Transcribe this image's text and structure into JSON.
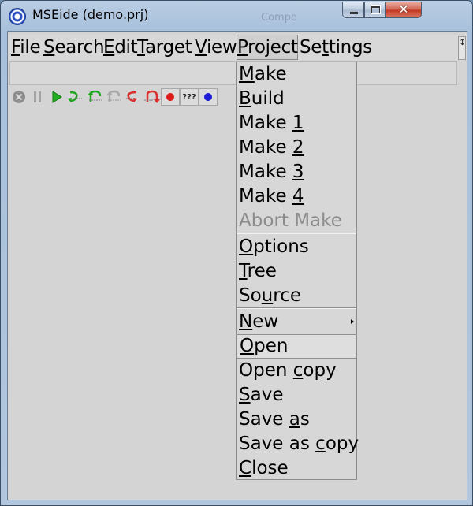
{
  "window": {
    "title": "MSEide (demo.prj)",
    "ghost_label": "Compo"
  },
  "menubar": {
    "items": [
      {
        "label": "File",
        "key": "F"
      },
      {
        "label": "Search",
        "key": "S"
      },
      {
        "label": "Edit",
        "key": "E"
      },
      {
        "label": "Target",
        "key": "T"
      },
      {
        "label": "View",
        "key": "V"
      },
      {
        "label": "Project",
        "key": "P"
      },
      {
        "label": "Settings",
        "key": "t"
      }
    ]
  },
  "toolbar": {
    "buttons": [
      {
        "icon": "stop-icon"
      },
      {
        "icon": "pause-icon"
      },
      {
        "icon": "run-icon"
      },
      {
        "icon": "step-into-icon"
      },
      {
        "icon": "step-over-icon"
      },
      {
        "icon": "step-disabled-icon"
      },
      {
        "icon": "step-out-icon"
      },
      {
        "icon": "step-back-icon"
      },
      {
        "icon": "breakpoint-icon"
      },
      {
        "icon": "unknown-icon",
        "label": "???"
      },
      {
        "icon": "watch-icon"
      }
    ]
  },
  "project_menu": {
    "items": [
      {
        "label": "Make",
        "underline": 0
      },
      {
        "label": "Build",
        "underline": 0
      },
      {
        "label": "Make 1",
        "underline": 5
      },
      {
        "label": "Make 2",
        "underline": 5
      },
      {
        "label": "Make 3",
        "underline": 5
      },
      {
        "label": "Make 4",
        "underline": 5
      },
      {
        "label": "Abort Make",
        "disabled": true
      },
      {
        "label": "Options",
        "underline": 0
      },
      {
        "label": "Tree",
        "underline": 0
      },
      {
        "label": "Source",
        "underline": 2
      },
      {
        "label": "New",
        "underline": 0,
        "submenu": true
      },
      {
        "label": "Open",
        "underline": 0,
        "highlighted": true
      },
      {
        "label": "Open copy",
        "underline": 7
      },
      {
        "label": "Save",
        "underline": 0
      },
      {
        "label": "Save as",
        "underline": 5
      },
      {
        "label": "Save as copy",
        "underline": 8
      },
      {
        "label": "Close",
        "underline": 0
      }
    ]
  }
}
